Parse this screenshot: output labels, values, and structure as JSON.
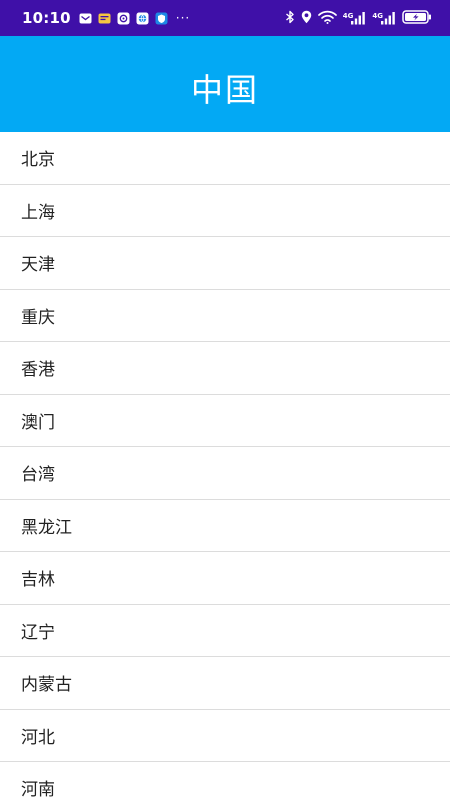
{
  "status_bar": {
    "time": "10:10",
    "more": "···",
    "signal_label_1": "4G",
    "signal_label_2": "4G",
    "background": "#3f10a8",
    "notification_icons": [
      "mail-icon",
      "message-icon",
      "app-icon",
      "browser-icon",
      "shield-app-icon"
    ],
    "system_icons": [
      "bluetooth-icon",
      "location-icon",
      "wifi-icon",
      "signal-icon",
      "signal-icon",
      "battery-charging-icon"
    ]
  },
  "app_bar": {
    "title": "中国",
    "background": "#03a9f4"
  },
  "list": {
    "items": [
      {
        "label": "北京"
      },
      {
        "label": "上海"
      },
      {
        "label": "天津"
      },
      {
        "label": "重庆"
      },
      {
        "label": "香港"
      },
      {
        "label": "澳门"
      },
      {
        "label": "台湾"
      },
      {
        "label": "黑龙江"
      },
      {
        "label": "吉林"
      },
      {
        "label": "辽宁"
      },
      {
        "label": "内蒙古"
      },
      {
        "label": "河北"
      },
      {
        "label": "河南"
      }
    ]
  }
}
